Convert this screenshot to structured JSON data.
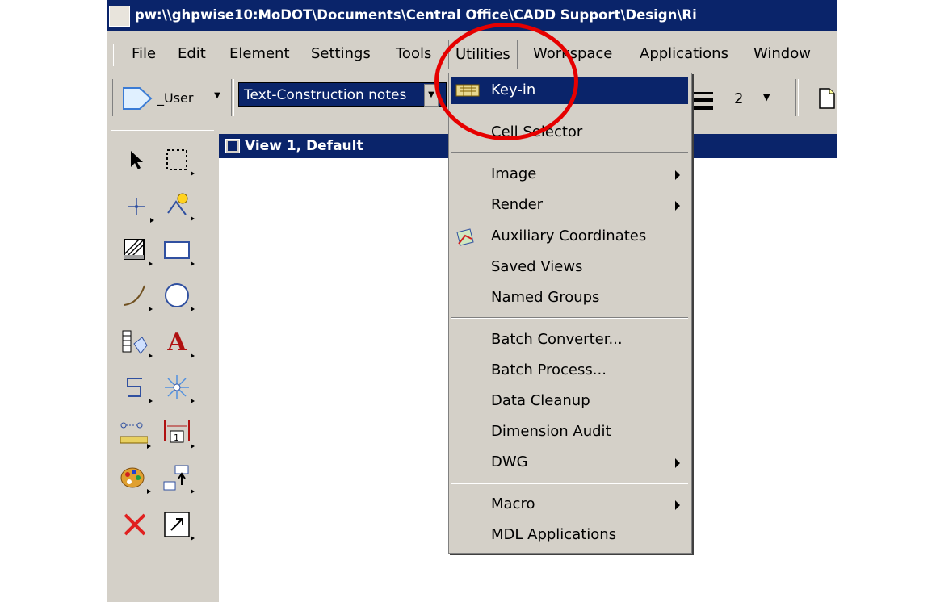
{
  "window": {
    "title": "pw:\\\\ghpwise10:MoDOT\\Documents\\Central Office\\CADD Support\\Design\\Ri"
  },
  "menubar": {
    "items": [
      "File",
      "Edit",
      "Element",
      "Settings",
      "Tools",
      "Utilities",
      "Workspace",
      "Applications",
      "Window"
    ],
    "active": "Utilities"
  },
  "toolbar": {
    "user_label": "_User",
    "level_value": "Text-Construction notes",
    "weight_value": "2"
  },
  "view": {
    "title": "View 1, Default"
  },
  "utilities_menu": {
    "items": [
      {
        "label": "Key-in",
        "highlighted": true
      },
      {
        "label": "Cell Selector"
      },
      {
        "label": "Image",
        "submenu": true
      },
      {
        "label": "Render",
        "submenu": true
      },
      {
        "label": "Auxiliary Coordinates"
      },
      {
        "label": "Saved Views"
      },
      {
        "label": "Named Groups"
      },
      {
        "label": "Batch Converter..."
      },
      {
        "label": "Batch Process..."
      },
      {
        "label": "Data Cleanup"
      },
      {
        "label": "Dimension Audit"
      },
      {
        "label": "DWG",
        "submenu": true
      },
      {
        "label": "Macro",
        "submenu": true
      },
      {
        "label": "MDL Applications"
      }
    ]
  },
  "tools": [
    "select-element-icon",
    "place-fence-icon",
    "snap-point-icon",
    "keypoint-snap-icon",
    "hatch-area-icon",
    "rectangle-icon",
    "arc-icon",
    "circle-icon",
    "cell-icon",
    "text-icon",
    "line-icon",
    "manipulate-icon",
    "measure-icon",
    "dimension-icon",
    "palette-icon",
    "group-icon",
    "delete-icon",
    "scale-icon"
  ],
  "colors": {
    "titlebar": "#0a246a",
    "highlight": "#0a246a",
    "annotation_circle": "#e60000",
    "chrome": "#d4d0c8"
  }
}
